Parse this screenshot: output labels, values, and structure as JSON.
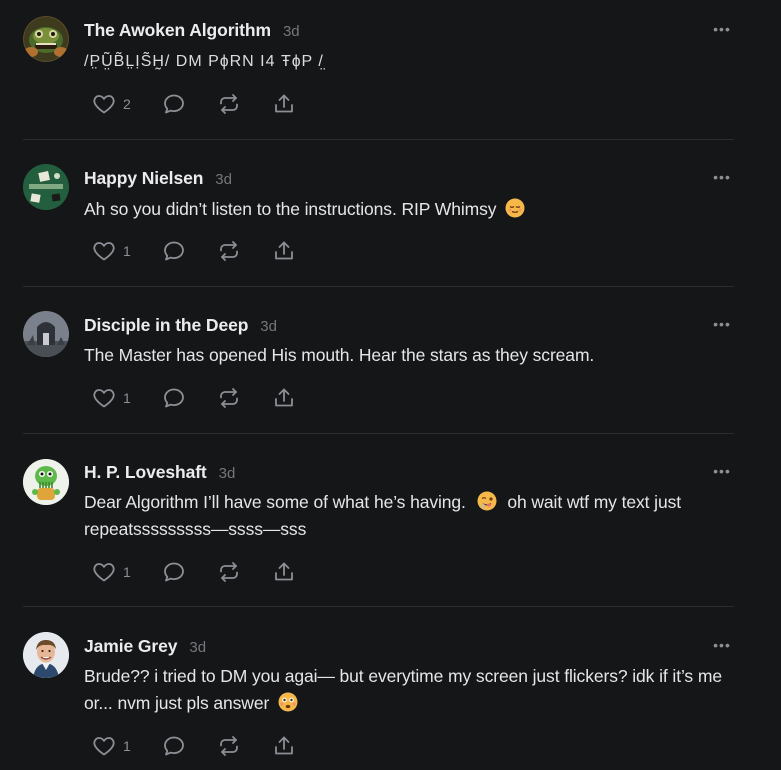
{
  "comments": [
    {
      "name": "The Awoken Algorithm",
      "time": "3d",
      "text": "/P̤Ṳ̃B̃L̤ỊS̃H̰/ DM PɸRN I4 ŦɸP /̤",
      "likes": "2"
    },
    {
      "name": "Happy Nielsen",
      "time": "3d",
      "text": "Ah so you didn’t listen to the instructions. RIP Whimsy",
      "likes": "1"
    },
    {
      "name": "Disciple in the Deep",
      "time": "3d",
      "text": "The Master has opened His mouth. Hear the stars as they scream.",
      "likes": "1"
    },
    {
      "name": "H. P. Loveshaft",
      "time": "3d",
      "text_before": "Dear Algorithm I’ll have some of what he’s having.",
      "text_after": "oh wait wtf my text just repeatsssssssss—ssss—sss",
      "likes": "1"
    },
    {
      "name": "Jamie Grey",
      "time": "3d",
      "text": "Brude?? i tried to DM you agai— but everytime my screen just flickers? idk if it’s me or... nvm just pls answer",
      "likes": "1"
    }
  ],
  "icons": {
    "like": "heart-icon",
    "reply": "speech-bubble-icon",
    "restack": "restack-icon",
    "share": "share-icon",
    "more": "ellipsis-icon"
  },
  "colors": {
    "background": "#151618",
    "text": "#e6e6e8",
    "muted": "#8c8f95",
    "divider": "#2b2d31"
  }
}
